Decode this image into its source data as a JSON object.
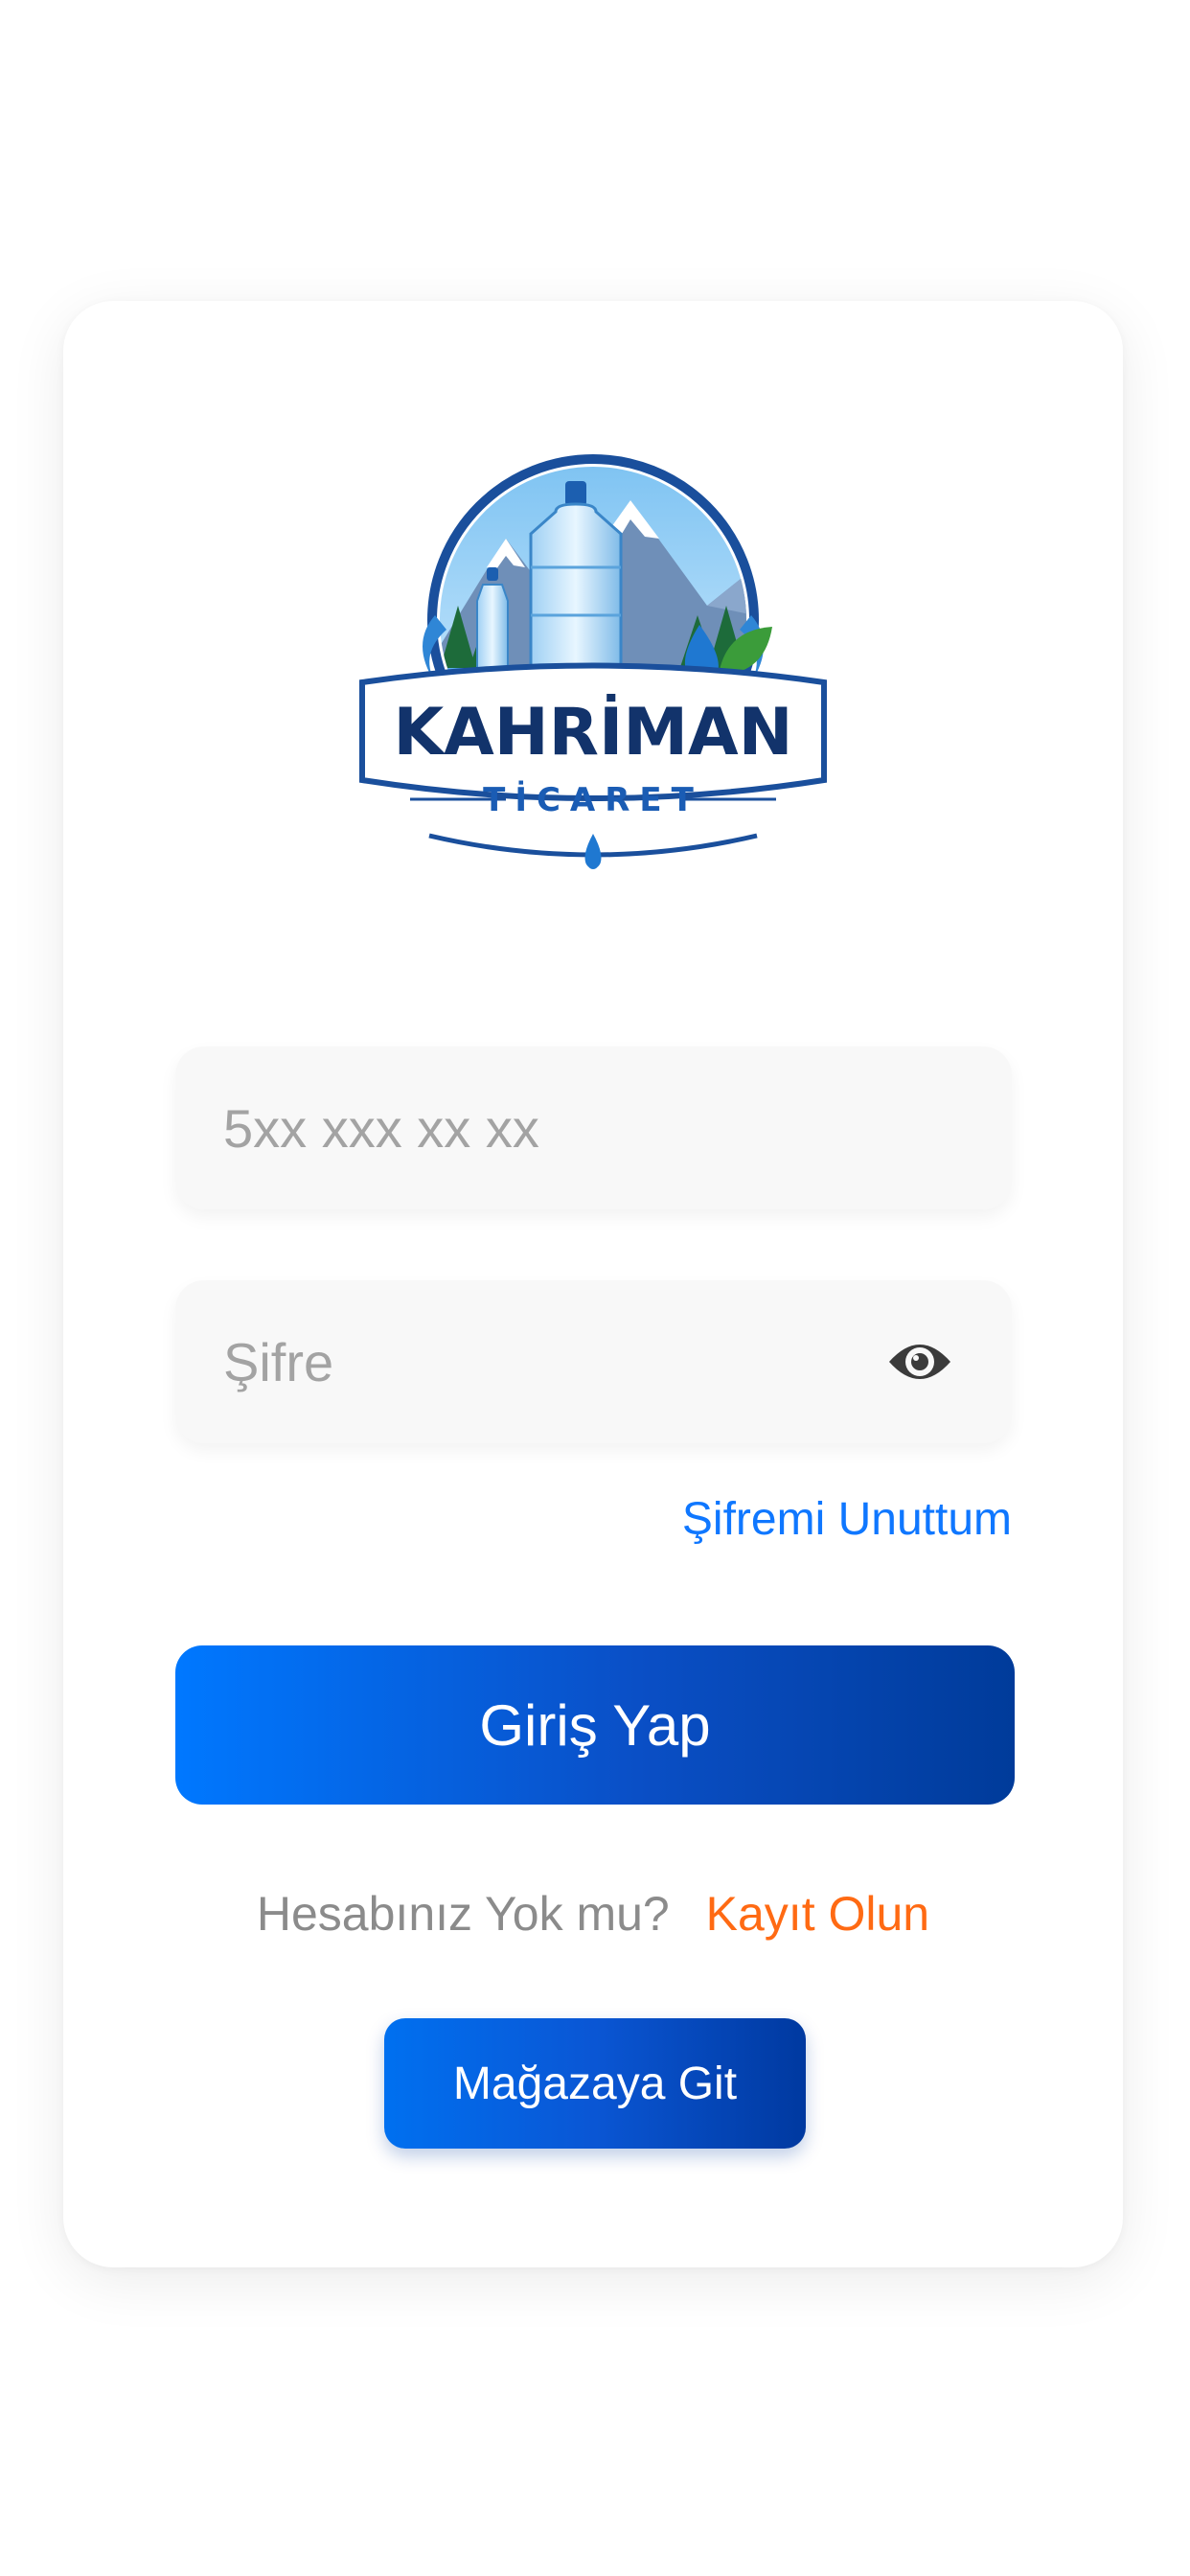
{
  "logo": {
    "brand": "KAHRİMAN",
    "subtitle": "TİCARET",
    "icon": "water-bottle-mountain-logo"
  },
  "login_form": {
    "phone_placeholder": "5xx xxx xx xx",
    "password_placeholder": "Şifre",
    "show_password_icon": "eye-icon",
    "forgot_password_label": "Şifremi Unuttum",
    "login_label": "Giriş Yap"
  },
  "signup": {
    "question": "Hesabınız Yok mu?",
    "link_label": "Kayıt Olun"
  },
  "store_button_label": "Mağazaya Git",
  "colors": {
    "primary_blue": "#0078ff",
    "dark_blue": "#003b9a",
    "link_blue": "#0f77ff",
    "accent_orange": "#ff6a13"
  }
}
